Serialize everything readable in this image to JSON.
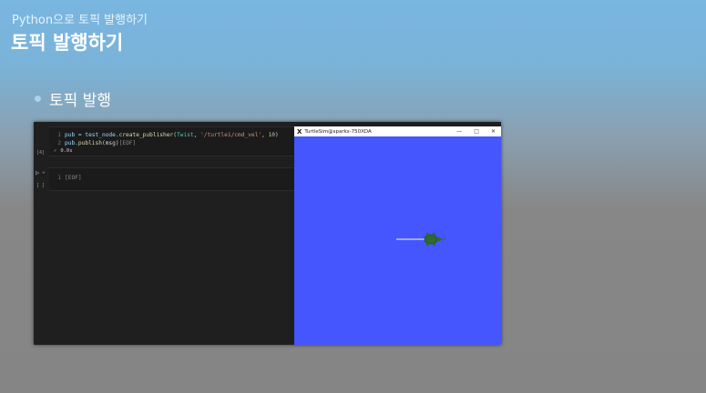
{
  "slide": {
    "subtitle": "Python으로 토픽 발행하기",
    "title": "토픽 발행하기",
    "bullet": "토픽 발행"
  },
  "notebook": {
    "cell1": {
      "exec_count": "[4]",
      "line1_no": "1",
      "line1": {
        "p1": "pub = test_node.",
        "fn": "create_publisher",
        "p2": "(",
        "cls": "Twist",
        "p3": ", ",
        "str": "'/turtle1/cmd_vel'",
        "p4": ", ",
        "num": "10",
        "p5": ")"
      },
      "line2_no": "2",
      "line2": {
        "p1": "pub.",
        "fn": "publish",
        "p2": "(msg)",
        "eof": "[EOF]"
      },
      "status_check": "✓",
      "status_time": "0.0s"
    },
    "cell2": {
      "exec_count": "[ ]",
      "run_icon": "▷",
      "chevron": "⌄",
      "line1_no": "1",
      "line1": "[EOF]"
    }
  },
  "turtlesim": {
    "x_logo": "X",
    "title": "TurtleSim@sparks-750XDA",
    "minimize": "—",
    "maximize": "□",
    "close": "✕",
    "background_color": "#4556ff",
    "turtle_color": "#2e6b2e",
    "trail_color": "#ffffff"
  }
}
